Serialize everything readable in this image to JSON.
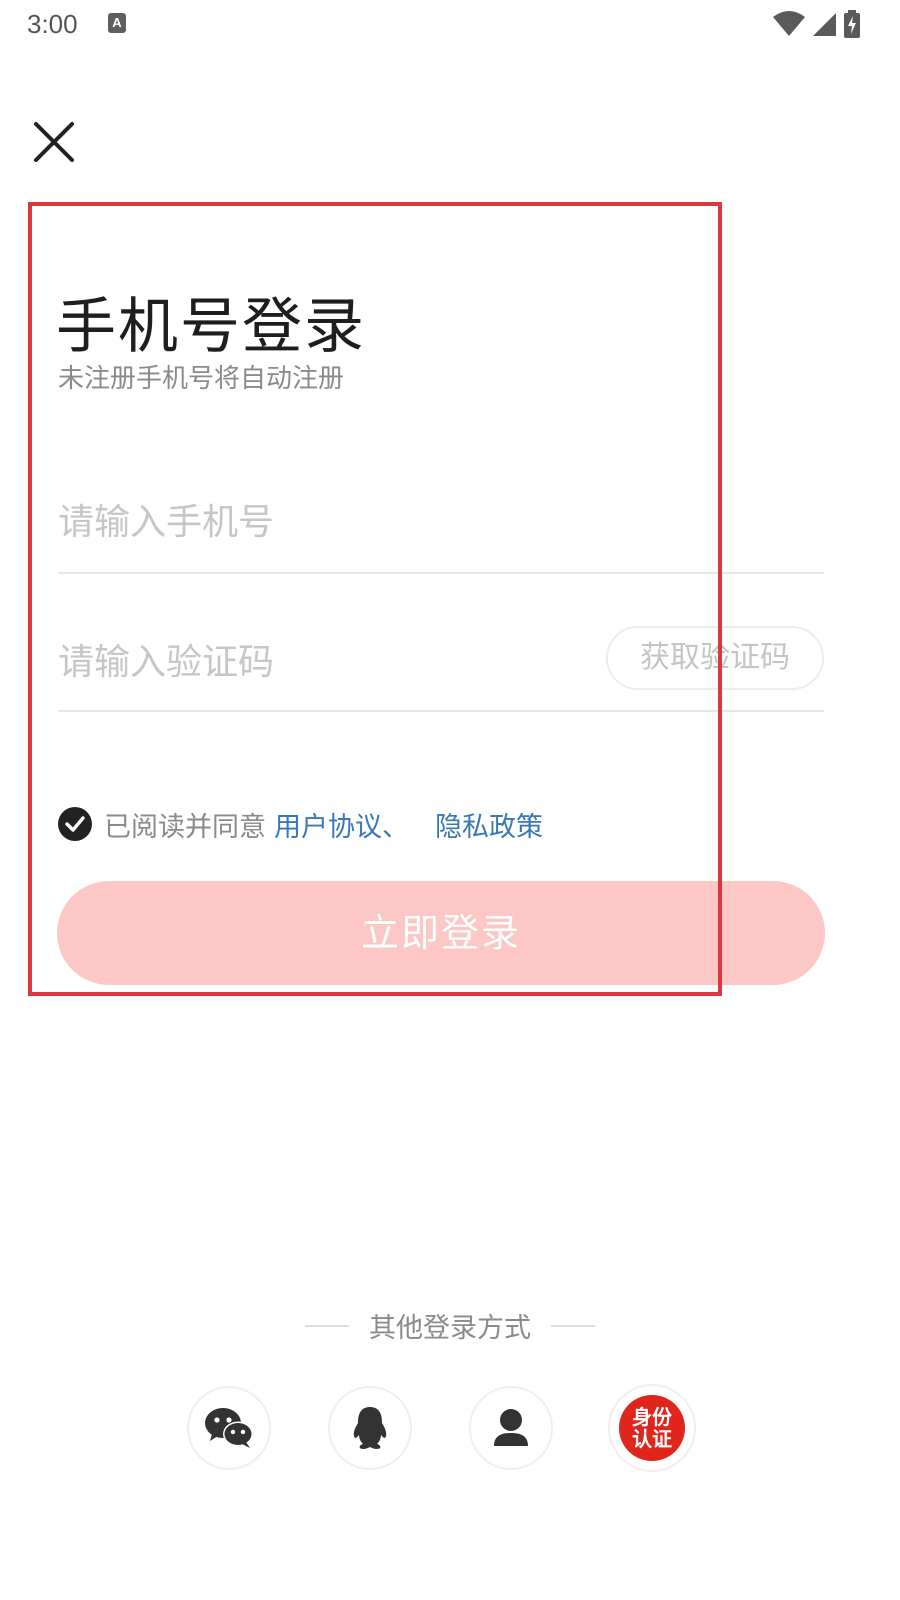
{
  "status_bar": {
    "time": "3:00",
    "app_badge": "A"
  },
  "login": {
    "title": "手机号登录",
    "subtitle": "未注册手机号将自动注册",
    "phone_placeholder": "请输入手机号",
    "code_placeholder": "请输入验证码",
    "get_code_label": "获取验证码",
    "agree_text": "已阅读并同意",
    "user_agreement_link": "用户协议、",
    "privacy_link": "隐私政策",
    "agreement_checked": true,
    "login_button_label": "立即登录"
  },
  "other_login": {
    "label": "其他登录方式",
    "methods": [
      {
        "name": "wechat",
        "icon": "wechat-icon"
      },
      {
        "name": "qq",
        "icon": "qq-penguin-icon"
      },
      {
        "name": "account",
        "icon": "user-icon"
      },
      {
        "name": "id-verify",
        "icon": "id-verify-icon",
        "badge_line1": "身份",
        "badge_line2": "认证"
      }
    ]
  },
  "colors": {
    "highlight_border": "#d8383f",
    "login_button_bg": "#fcc7c5",
    "link": "#3a78b5",
    "id_badge": "#e0251c"
  }
}
